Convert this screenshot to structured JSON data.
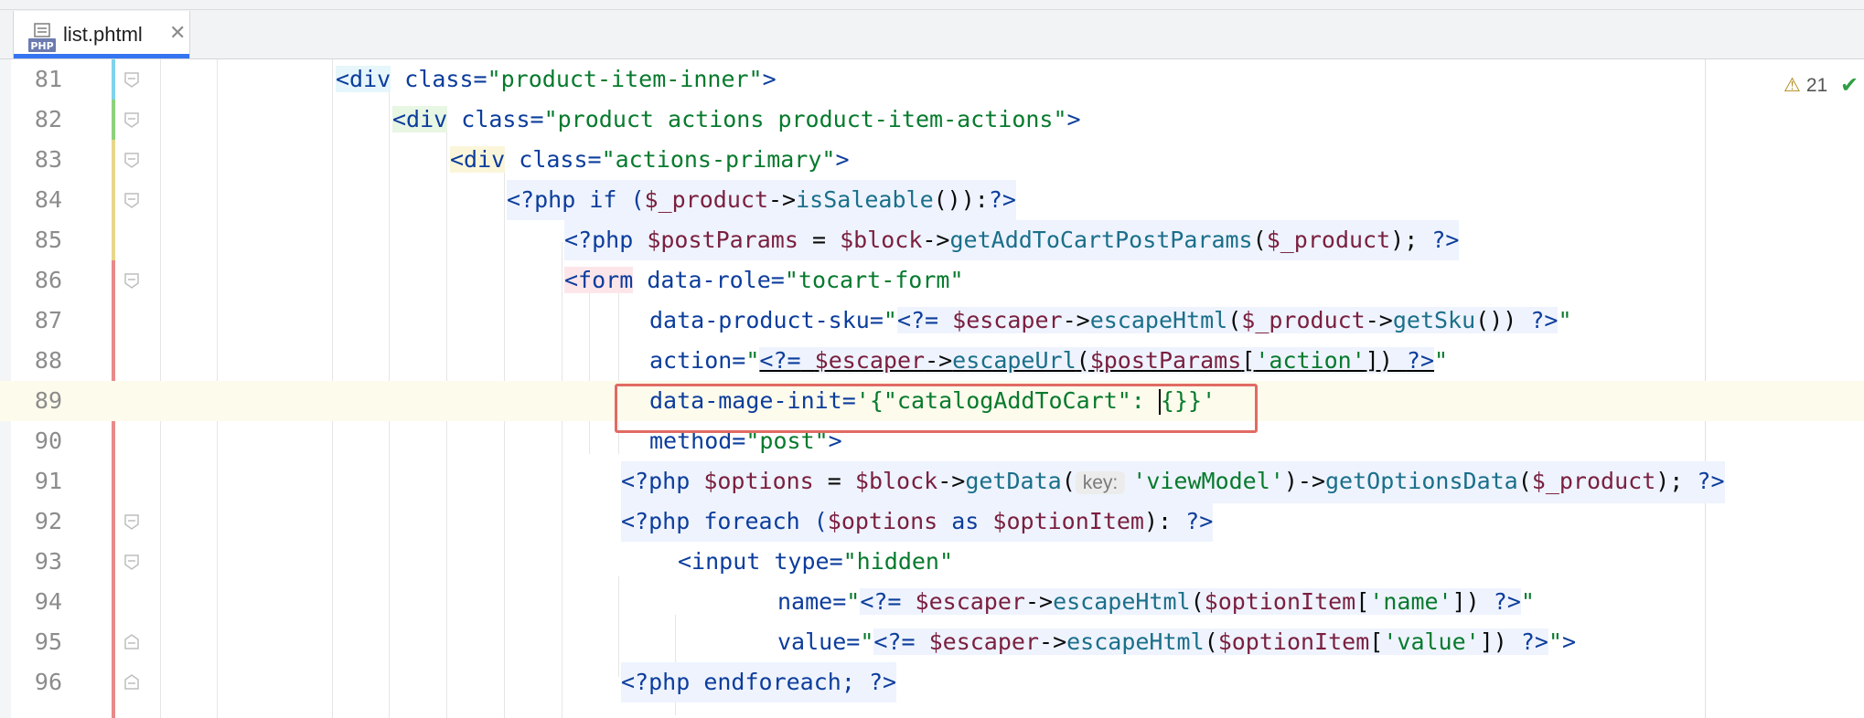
{
  "tab": {
    "file_name": "list.phtml",
    "icon_label": "PHP",
    "close_glyph": "✕"
  },
  "inspection": {
    "warning_count": "21"
  },
  "lines": [
    {
      "num": "81"
    },
    {
      "num": "82"
    },
    {
      "num": "83"
    },
    {
      "num": "84"
    },
    {
      "num": "85"
    },
    {
      "num": "86"
    },
    {
      "num": "87"
    },
    {
      "num": "88"
    },
    {
      "num": "89"
    },
    {
      "num": "90"
    },
    {
      "num": "91"
    },
    {
      "num": "92"
    },
    {
      "num": "93"
    },
    {
      "num": "94"
    },
    {
      "num": "95"
    },
    {
      "num": "96"
    }
  ],
  "code": {
    "l81": [
      "<div",
      " class=",
      "\"product-item-inner\"",
      ">"
    ],
    "l82": [
      "<div",
      " class=",
      "\"product actions product-item-actions\"",
      ">"
    ],
    "l83": [
      "<div",
      " class=",
      "\"actions-primary\"",
      ">"
    ],
    "l84": [
      "<?php",
      " if (",
      "$_product",
      "->",
      "isSaleable",
      "()):",
      "?>"
    ],
    "l85": [
      "<?php",
      " ",
      "$postParams",
      " = ",
      "$block",
      "->",
      "getAddToCartPostParams",
      "(",
      "$_product",
      "); ",
      "?>"
    ],
    "l86": [
      "<form",
      " data-role=",
      "\"tocart-form\""
    ],
    "l87": [
      "data-product-sku=",
      "\"",
      "<?=",
      " ",
      "$escaper",
      "->",
      "escapeHtml",
      "(",
      "$_product",
      "->",
      "getSku",
      "()) ",
      "?>",
      "\""
    ],
    "l88": [
      "action=",
      "\"",
      "<?=",
      " ",
      "$escaper",
      "->",
      "escapeUrl",
      "(",
      "$postParams",
      "[",
      "'action'",
      "]) ",
      "?>",
      "\""
    ],
    "l89": [
      "data-mage-init=",
      "'{\"catalogAddToCart\": ",
      "{}}'"
    ],
    "l90": [
      "method=",
      "\"post\"",
      ">"
    ],
    "l91": [
      "<?php",
      " ",
      "$options",
      " = ",
      "$block",
      "->",
      "getData",
      "(",
      "key:",
      " ",
      "'viewModel'",
      ")->",
      "getOptionsData",
      "(",
      "$_product",
      "); ",
      "?>"
    ],
    "l92": [
      "<?php",
      " foreach (",
      "$options",
      " as ",
      "$optionItem",
      "): ",
      "?>"
    ],
    "l93": [
      "<input",
      " type=",
      "\"hidden\""
    ],
    "l94": [
      "name=",
      "\"",
      "<?=",
      " ",
      "$escaper",
      "->",
      "escapeHtml",
      "(",
      "$optionItem",
      "[",
      "'name'",
      "]) ",
      "?>",
      "\""
    ],
    "l95": [
      "value=",
      "\"",
      "<?=",
      " ",
      "$escaper",
      "->",
      "escapeHtml",
      "(",
      "$optionItem",
      "[",
      "'value'",
      "]) ",
      "?>",
      "\"",
      ">"
    ],
    "l96": [
      "<?php",
      " endforeach; ",
      "?>"
    ]
  },
  "colors": {
    "tag": "#0c3d9c",
    "string": "#077a2d",
    "variable": "#7a1f3f",
    "method": "#1a6f8a",
    "highlight_box": "#e06b63",
    "tab_underline": "#3574f0"
  }
}
